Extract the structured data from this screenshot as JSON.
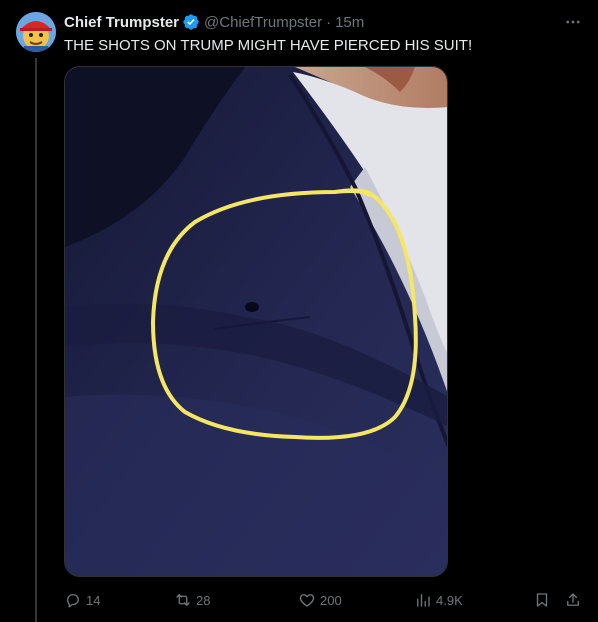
{
  "tweet": {
    "display_name": "Chief Trumpster",
    "handle": "@ChiefTrumpster",
    "separator": "·",
    "time": "15m",
    "text": "THE SHOTS ON TRUMP MIGHT HAVE PIERCED HIS SUIT!",
    "verified": true,
    "avatar_icon": "cartoon-avatar-red-cap"
  },
  "media": {
    "annotation_icon": "yellow-circle-annotation",
    "highlight_color": "#f5e663",
    "suit_color": "#1e2147"
  },
  "actions": {
    "replies": "14",
    "reposts": "28",
    "likes": "200",
    "views": "4.9K"
  },
  "colors": {
    "background": "#000000",
    "text": "#e7e9ea",
    "muted": "#71767b",
    "verified": "#1d9bf0"
  }
}
